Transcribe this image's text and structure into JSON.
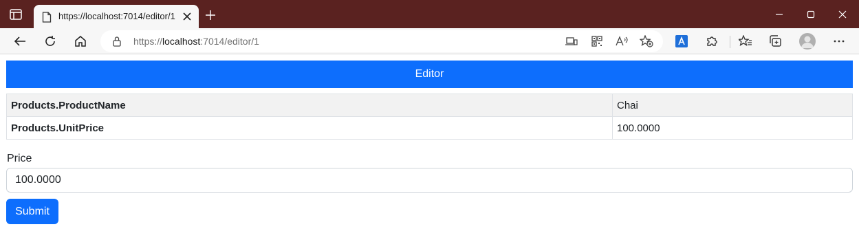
{
  "browser": {
    "tab_title": "https://localhost:7014/editor/1",
    "url_prefix": "https://",
    "url_host": "localhost",
    "url_rest": ":7014/editor/1",
    "icons": {
      "window_menu": "window-menu-icon",
      "favicon": "page-icon",
      "tab_close": "close-icon",
      "new_tab": "plus-icon",
      "minimize": "minimize-icon",
      "maximize": "maximize-icon",
      "close_window": "close-icon",
      "back": "back-arrow-icon",
      "refresh": "refresh-icon",
      "home": "home-icon",
      "lock": "lock-icon",
      "app_available": "app-available-icon",
      "qr_code": "qr-code-icon",
      "read_aloud": "read-aloud-icon",
      "add_favorite": "star-plus-icon",
      "translate": "translate-icon",
      "extensions": "puzzle-icon",
      "favorites": "favorites-icon",
      "collections": "collections-icon",
      "profile": "profile-avatar",
      "more": "more-icon"
    },
    "colors": {
      "titlebar": "#5a2220",
      "toolbar": "#f7f7f7"
    }
  },
  "page": {
    "header": "Editor",
    "table": [
      {
        "field": "Products.ProductName",
        "value": "Chai"
      },
      {
        "field": "Products.UnitPrice",
        "value": "100.0000"
      }
    ],
    "price_label": "Price",
    "price_value": "100.0000",
    "submit_label": "Submit",
    "colors": {
      "primary": "#0d6efd"
    }
  }
}
